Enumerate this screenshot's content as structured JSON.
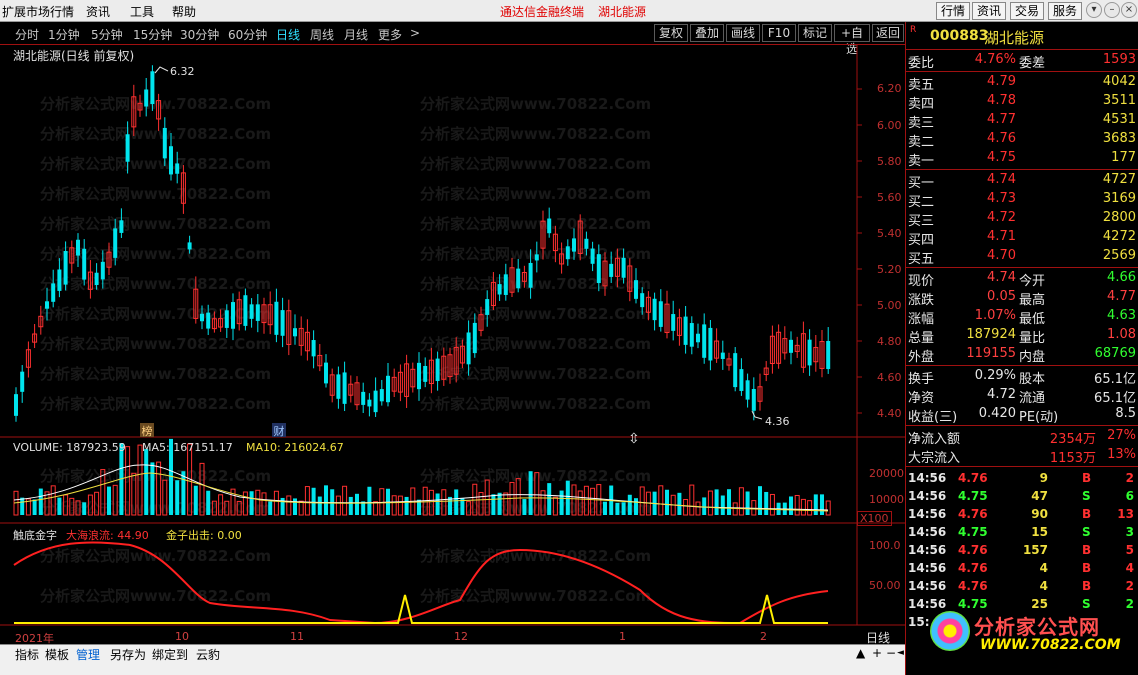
{
  "menu": {
    "items": [
      "扩展市场行情",
      "资讯",
      "工具",
      "帮助"
    ],
    "center_title": "通达信金融终端",
    "center_stock": "湖北能源",
    "right_buttons": [
      "行情",
      "资讯",
      "交易",
      "服务"
    ]
  },
  "tabs": {
    "items": [
      "分时",
      "1分钟",
      "5分钟",
      "15分钟",
      "30分钟",
      "60分钟",
      "日线",
      "周线",
      "月线",
      "更多"
    ],
    "active": "日线",
    "more_arrow": ">"
  },
  "toolbar": {
    "buttons": [
      "复权",
      "叠加",
      "画线",
      "F10",
      "标记",
      "+自选",
      "返回"
    ]
  },
  "chart": {
    "header": "湖北能源(日线 前复权)",
    "high_label": "6.32",
    "low_label": "4.36",
    "price_ticks": [
      "6.20",
      "6.00",
      "5.80",
      "5.60",
      "5.40",
      "5.20",
      "5.00",
      "4.80",
      "4.60",
      "4.40"
    ],
    "badges": [
      "榜",
      "财"
    ],
    "volume": {
      "label": "VOLUME: 187923.59",
      "ma5": "MA5: 167151.17",
      "ma10": "MA10: 216024.67",
      "ticks": [
        "20000",
        "10000"
      ],
      "unit": "X100"
    },
    "indicator": {
      "name": "触底金字",
      "line1": "大海浪流: 44.90",
      "line2": "金子出击: 0.00",
      "ticks": [
        "100.0",
        "50.00"
      ]
    },
    "dates": [
      "2021年",
      "10",
      "11",
      "12",
      "1",
      "2"
    ],
    "period_label": "日线",
    "watermark": "分析家公式网www.70822.Com"
  },
  "side": {
    "code": "000883",
    "name": "湖北能源",
    "marker": "R",
    "weibi": {
      "label": "委比",
      "value": "4.76%",
      "label2": "委差",
      "value2": "1593"
    },
    "asks": [
      {
        "label": "卖五",
        "price": "4.79",
        "vol": "4042"
      },
      {
        "label": "卖四",
        "price": "4.78",
        "vol": "3511"
      },
      {
        "label": "卖三",
        "price": "4.77",
        "vol": "4531"
      },
      {
        "label": "卖二",
        "price": "4.76",
        "vol": "3683"
      },
      {
        "label": "卖一",
        "price": "4.75",
        "vol": "177"
      }
    ],
    "bids": [
      {
        "label": "买一",
        "price": "4.74",
        "vol": "4727"
      },
      {
        "label": "买二",
        "price": "4.73",
        "vol": "3169"
      },
      {
        "label": "买三",
        "price": "4.72",
        "vol": "2800"
      },
      {
        "label": "买四",
        "price": "4.71",
        "vol": "4272"
      },
      {
        "label": "买五",
        "price": "4.70",
        "vol": "2569"
      }
    ],
    "quote": [
      {
        "l1": "现价",
        "v1": "4.74",
        "c1": "#ff4040",
        "l2": "今开",
        "v2": "4.66",
        "c2": "#30ff30"
      },
      {
        "l1": "涨跌",
        "v1": "0.05",
        "c1": "#ff4040",
        "l2": "最高",
        "v2": "4.77",
        "c2": "#ff4040"
      },
      {
        "l1": "涨幅",
        "v1": "1.07%",
        "c1": "#ff4040",
        "l2": "最低",
        "v2": "4.63",
        "c2": "#30ff30"
      },
      {
        "l1": "总量",
        "v1": "187924",
        "c1": "#f0e040",
        "l2": "量比",
        "v2": "1.08",
        "c2": "#ff4040"
      },
      {
        "l1": "外盘",
        "v1": "119155",
        "c1": "#ff4040",
        "l2": "内盘",
        "v2": "68769",
        "c2": "#30ff30"
      }
    ],
    "fund": [
      {
        "l1": "换手",
        "v1": "0.29%",
        "l2": "股本",
        "v2": "65.1亿"
      },
      {
        "l1": "净资",
        "v1": "4.72",
        "l2": "流通",
        "v2": "65.1亿"
      },
      {
        "l1": "收益(三)",
        "v1": "0.420",
        "l2": "PE(动)",
        "v2": "8.5"
      }
    ],
    "flow": [
      {
        "label": "净流入额",
        "value": "2354万",
        "pct": "27%"
      },
      {
        "label": "大宗流入",
        "value": "1153万",
        "pct": "13%"
      }
    ],
    "ticks": [
      {
        "t": "14:56",
        "p": "4.76",
        "v": "9",
        "d": "B",
        "n": "2"
      },
      {
        "t": "14:56",
        "p": "4.75",
        "v": "47",
        "d": "S",
        "n": "6"
      },
      {
        "t": "14:56",
        "p": "4.76",
        "v": "90",
        "d": "B",
        "n": "13"
      },
      {
        "t": "14:56",
        "p": "4.75",
        "v": "15",
        "d": "S",
        "n": "3"
      },
      {
        "t": "14:56",
        "p": "4.76",
        "v": "157",
        "d": "B",
        "n": "5"
      },
      {
        "t": "14:56",
        "p": "4.76",
        "v": "4",
        "d": "B",
        "n": "4"
      },
      {
        "t": "14:56",
        "p": "4.76",
        "v": "4",
        "d": "B",
        "n": "2"
      },
      {
        "t": "14:56",
        "p": "4.75",
        "v": "25",
        "d": "S",
        "n": "2"
      },
      {
        "t": "15:",
        "p": "",
        "v": "",
        "d": "",
        "n": ""
      }
    ],
    "logo_text": "分析家公式网",
    "logo_url": "WWW.70822.COM"
  },
  "bottom": {
    "buttons": [
      "指标",
      "模板",
      "管理",
      "另存为",
      "绑定到",
      "云豹"
    ],
    "active": "管理",
    "nav": [
      "▲",
      "+",
      "−",
      "◄"
    ]
  },
  "colors": {
    "up": "#ff3030",
    "down": "#00e5ee",
    "ma5": "#ffffff",
    "ma10": "#f0e040",
    "ind_red": "#ff2020",
    "ind_yellow": "#ffee00"
  }
}
